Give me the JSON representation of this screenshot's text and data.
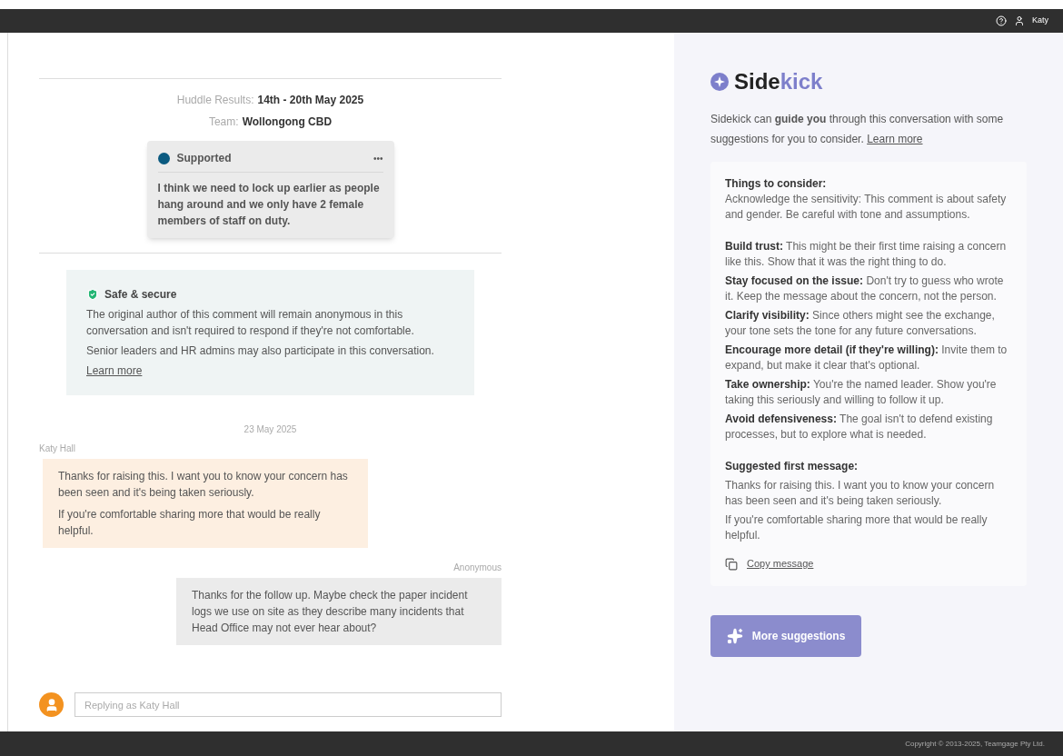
{
  "top_bar": {
    "user_name": "Katy"
  },
  "huddle": {
    "results_label": "Huddle Results:",
    "results_value": "14th - 20th May 2025",
    "team_label": "Team:",
    "team_value": "Wollongong CBD"
  },
  "comment_card": {
    "status": "Supported",
    "color": "#0b5a80",
    "menu": "•••",
    "text": "I think we need to lock up earlier as people hang around and we only have 2 female members of staff on duty."
  },
  "safe_notice": {
    "title": "Safe & secure",
    "paragraphs": [
      "The original author of this comment will remain anonymous in this conversation and isn't required to respond if they're not comfortable.",
      "Senior leaders and HR admins may also participate in this conversation."
    ],
    "link": "Learn more"
  },
  "conversation": {
    "date": "23 May 2025",
    "messages": [
      {
        "author": "Katy Hall",
        "kind": "own",
        "paragraphs": [
          "Thanks for raising this. I want you to know your concern has been seen and it's being taken seriously.",
          "If you're comfortable sharing more that would be really helpful."
        ]
      },
      {
        "author": "Anonymous",
        "kind": "other",
        "paragraphs": [
          "Thanks for the follow up. Maybe check the paper incident logs we use on site as they describe many incidents that Head Office may not ever hear about?"
        ]
      }
    ]
  },
  "reply": {
    "placeholder": "Replying as Katy Hall"
  },
  "sidekick": {
    "title_parts": [
      "Side",
      "kick"
    ],
    "intro": "Sidekick can **guide you** through this conversation with some suggestions for you to consider.",
    "intro_link": "Learn more",
    "considerations_title": "Things to consider:",
    "considerations_lead": "Acknowledge the sensitivity: This comment is about safety and gender. Be careful with tone and assumptions.",
    "considerations": [
      "**Build trust:** This might be their first time raising a concern like this. Show that it was the right thing to do.",
      "**Stay focused on the issue:** Don't try to guess who wrote it. Keep the message about the concern, not the person.",
      "**Clarify visibility:** Since others might see the exchange, your tone sets the tone for any future conversations.",
      "**Encourage more detail (if they're willing):** Invite them to expand, but make it clear that's optional.",
      "**Take ownership:** You're the named leader. Show you're taking this seriously and willing to follow it up.",
      "**Avoid defensiveness:** The goal isn't to defend existing processes, but to explore what is needed."
    ],
    "suggested_title": "Suggested first message:",
    "suggested_paragraphs": [
      "Thanks for raising this. I want you to know your concern has been seen and it's being taken seriously.",
      "If you're comfortable sharing more that would be really helpful."
    ],
    "copy_button": "Copy message",
    "more_button": "More suggestions"
  },
  "footer": {
    "copyright": "Copyright © 2013-2025, Teamgage Pty Ltd."
  }
}
